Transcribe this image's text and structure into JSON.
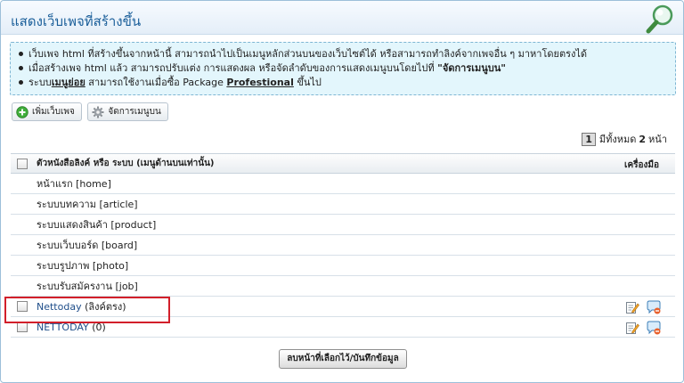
{
  "panel": {
    "title": "แสดงเว็บเพจที่สร้างขึ้น"
  },
  "info": {
    "line1": "เว็บเพจ html ที่สร้างขึ้นจากหน้านี้ สามารถนำไปเป็นเมนูหลักส่วนบนของเว็บไซต์ได้ หรือสามารถทำลิงค์จากเพจอื่น ๆ มาหาโดยตรงได้",
    "line2_prefix": "เมื่อสร้างเพจ html แล้ว สามารถปรับแต่ง การแสดงผล หรือจัดลำดับของการแสดงเมนูบนโดยไปที่ ",
    "line2_bold": "\"จัดการเมนูบน\"",
    "line3_prefix": "ระบบ",
    "line3_bold": "เมนูย่อย",
    "line3_mid": " สามารถใช้งานเมื่อซื้อ Package ",
    "line3_pkg": "Profestional",
    "line3_suffix": " ขึ้นไป"
  },
  "toolbar": {
    "add_page": "เพิ่มเว็บเพจ",
    "manage_menu": "จัดการเมนูบน"
  },
  "pager": {
    "current": "1",
    "prefix": "มีทั้งหมด",
    "total": "2",
    "suffix": "หน้า"
  },
  "list": {
    "header_title": "ตัวหนังสือลิงค์ หรือ ระบบ (เมนูด้านบนเท่านั้น)",
    "header_tools": "เครื่องมือ",
    "system_rows": [
      "หน้าแรก [home]",
      "ระบบบทความ [article]",
      "ระบบแสดงสินค้า [product]",
      "ระบบเว็บบอร์ด [board]",
      "ระบบรูปภาพ [photo]",
      "ระบบรับสมัครงาน [job]"
    ],
    "page_rows": [
      {
        "link": "Nettoday",
        "note": "(ลิงค์ตรง)"
      },
      {
        "link": "NETTODAY",
        "note": "(0)"
      }
    ]
  },
  "footer": {
    "save_button": "ลบหน้าที่เลือกไว้/บันทึกข้อมูล"
  },
  "colors": {
    "title": "#1b5f9a",
    "link": "#1f4e8a",
    "info_bg": "#e3f6fc",
    "highlight": "#d21f2a"
  }
}
